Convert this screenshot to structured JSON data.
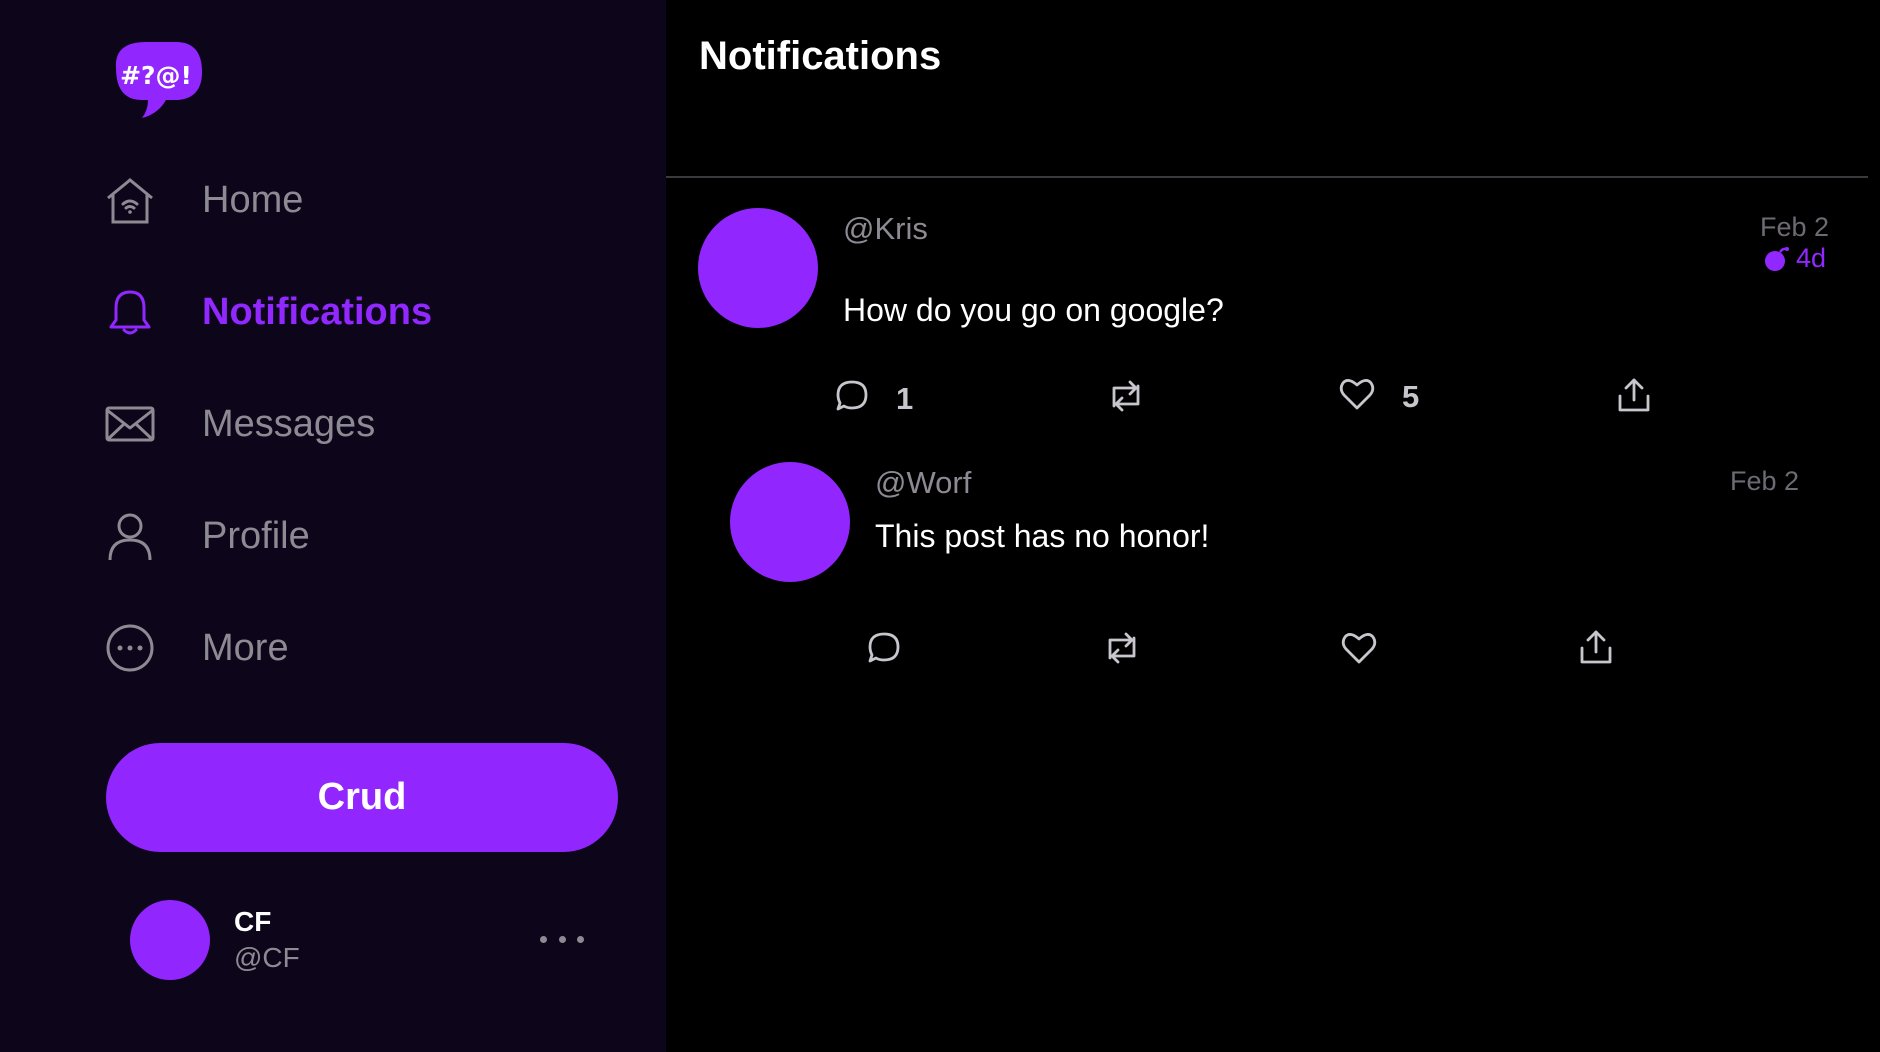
{
  "app": {
    "logo_text": "#?@!",
    "accent_color": "#9126ff"
  },
  "sidebar": {
    "items": [
      {
        "label": "Home",
        "icon": "home-icon"
      },
      {
        "label": "Notifications",
        "icon": "bell-icon",
        "active": true
      },
      {
        "label": "Messages",
        "icon": "envelope-icon"
      },
      {
        "label": "Profile",
        "icon": "user-icon"
      },
      {
        "label": "More",
        "icon": "more-circle-icon"
      }
    ],
    "primary_button": "Crud"
  },
  "account": {
    "name": "CF",
    "handle": "@CF"
  },
  "main": {
    "title": "Notifications"
  },
  "posts": [
    {
      "handle": "@Kris",
      "date": "Feb 2",
      "age": "4d",
      "body": "How do you go on google?",
      "reply_count": "1",
      "like_count": "5"
    },
    {
      "handle": "@Worf",
      "date": "Feb 2",
      "body": "This post has no honor!"
    }
  ]
}
